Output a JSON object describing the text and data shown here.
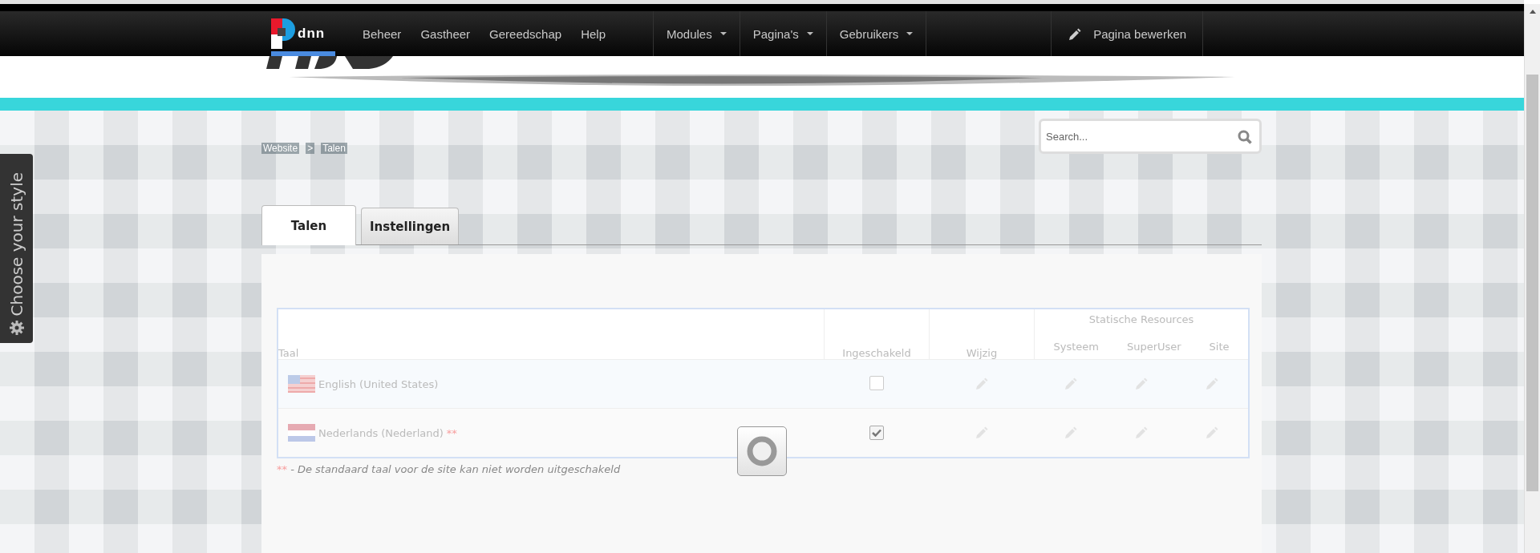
{
  "navbar": {
    "logo_text": "dnn",
    "menu": [
      {
        "label": "Beheer"
      },
      {
        "label": "Gastheer"
      },
      {
        "label": "Gereedschap"
      },
      {
        "label": "Help"
      }
    ],
    "dropdowns": [
      {
        "label": "Modules"
      },
      {
        "label": "Pagina's"
      },
      {
        "label": "Gebruikers"
      }
    ],
    "edit_button": "Pagina bewerken"
  },
  "style_tab": "Choose your style",
  "breadcrumb": {
    "items": [
      "Website",
      "Talen"
    ],
    "separator": ">"
  },
  "search": {
    "placeholder": "Search..."
  },
  "tabs": [
    {
      "label": "Talen",
      "selected": true
    },
    {
      "label": "Instellingen",
      "selected": false
    }
  ],
  "table": {
    "columns": [
      "Taal",
      "Ingeschakeld",
      "Wijzig"
    ],
    "group_header": "Statische Resources",
    "subcolumns": [
      "Systeem",
      "SuperUser",
      "Site"
    ],
    "rows": [
      {
        "kind": "us",
        "language": "English (United States)",
        "enabled": false
      },
      {
        "kind": "nl",
        "language": "Nederlands (Nederland)",
        "marker": "**",
        "enabled": true
      }
    ]
  },
  "footnote": {
    "marker": "**",
    "text": "- De standaard taal voor de site kan niet worden uitgeschakeld"
  },
  "loading": true
}
